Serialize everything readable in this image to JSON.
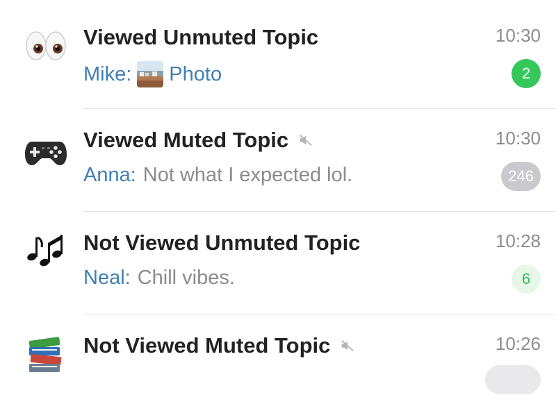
{
  "topics": [
    {
      "icon": "eyes-icon",
      "title": "Viewed Unmuted Topic",
      "time": "10:30",
      "sender": "Mike:",
      "message": "Photo",
      "has_photo": true,
      "muted": false,
      "unread": "2",
      "badge_style": "green"
    },
    {
      "icon": "game-controller-icon",
      "title": "Viewed Muted Topic",
      "time": "10:30",
      "sender": "Anna:",
      "message": "Not what I expected lol.",
      "muted": true,
      "unread": "246",
      "badge_style": "gray"
    },
    {
      "icon": "music-notes-icon",
      "title": "Not Viewed Unmuted Topic",
      "time": "10:28",
      "sender": "Neal:",
      "message": "Chill vibes.",
      "muted": false,
      "unread": "6",
      "badge_style": "light-green"
    },
    {
      "icon": "books-icon",
      "title": "Not Viewed Muted Topic",
      "time": "10:26",
      "muted": true
    }
  ],
  "colors": {
    "sender": "#3f7fb3",
    "badge_green": "#35c759",
    "badge_gray": "#c9c9ce",
    "badge_light_green": "#e6f7e8"
  }
}
